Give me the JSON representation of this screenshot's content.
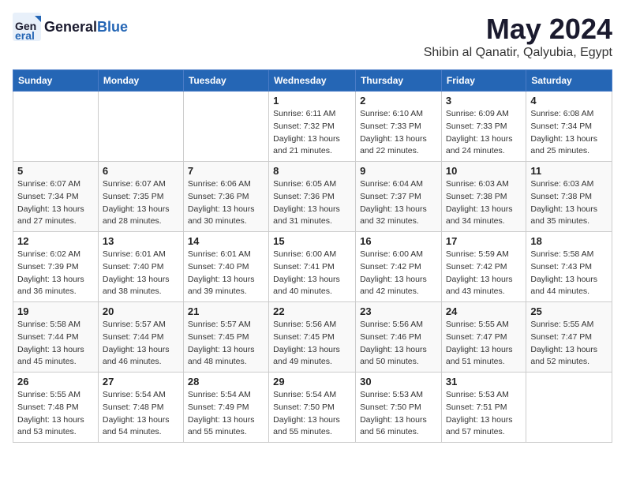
{
  "header": {
    "logo_general": "General",
    "logo_blue": "Blue",
    "month": "May 2024",
    "location": "Shibin al Qanatir, Qalyubia, Egypt"
  },
  "weekdays": [
    "Sunday",
    "Monday",
    "Tuesday",
    "Wednesday",
    "Thursday",
    "Friday",
    "Saturday"
  ],
  "weeks": [
    [
      {
        "day": "",
        "info": ""
      },
      {
        "day": "",
        "info": ""
      },
      {
        "day": "",
        "info": ""
      },
      {
        "day": "1",
        "info": "Sunrise: 6:11 AM\nSunset: 7:32 PM\nDaylight: 13 hours and 21 minutes."
      },
      {
        "day": "2",
        "info": "Sunrise: 6:10 AM\nSunset: 7:33 PM\nDaylight: 13 hours and 22 minutes."
      },
      {
        "day": "3",
        "info": "Sunrise: 6:09 AM\nSunset: 7:33 PM\nDaylight: 13 hours and 24 minutes."
      },
      {
        "day": "4",
        "info": "Sunrise: 6:08 AM\nSunset: 7:34 PM\nDaylight: 13 hours and 25 minutes."
      }
    ],
    [
      {
        "day": "5",
        "info": "Sunrise: 6:07 AM\nSunset: 7:34 PM\nDaylight: 13 hours and 27 minutes."
      },
      {
        "day": "6",
        "info": "Sunrise: 6:07 AM\nSunset: 7:35 PM\nDaylight: 13 hours and 28 minutes."
      },
      {
        "day": "7",
        "info": "Sunrise: 6:06 AM\nSunset: 7:36 PM\nDaylight: 13 hours and 30 minutes."
      },
      {
        "day": "8",
        "info": "Sunrise: 6:05 AM\nSunset: 7:36 PM\nDaylight: 13 hours and 31 minutes."
      },
      {
        "day": "9",
        "info": "Sunrise: 6:04 AM\nSunset: 7:37 PM\nDaylight: 13 hours and 32 minutes."
      },
      {
        "day": "10",
        "info": "Sunrise: 6:03 AM\nSunset: 7:38 PM\nDaylight: 13 hours and 34 minutes."
      },
      {
        "day": "11",
        "info": "Sunrise: 6:03 AM\nSunset: 7:38 PM\nDaylight: 13 hours and 35 minutes."
      }
    ],
    [
      {
        "day": "12",
        "info": "Sunrise: 6:02 AM\nSunset: 7:39 PM\nDaylight: 13 hours and 36 minutes."
      },
      {
        "day": "13",
        "info": "Sunrise: 6:01 AM\nSunset: 7:40 PM\nDaylight: 13 hours and 38 minutes."
      },
      {
        "day": "14",
        "info": "Sunrise: 6:01 AM\nSunset: 7:40 PM\nDaylight: 13 hours and 39 minutes."
      },
      {
        "day": "15",
        "info": "Sunrise: 6:00 AM\nSunset: 7:41 PM\nDaylight: 13 hours and 40 minutes."
      },
      {
        "day": "16",
        "info": "Sunrise: 6:00 AM\nSunset: 7:42 PM\nDaylight: 13 hours and 42 minutes."
      },
      {
        "day": "17",
        "info": "Sunrise: 5:59 AM\nSunset: 7:42 PM\nDaylight: 13 hours and 43 minutes."
      },
      {
        "day": "18",
        "info": "Sunrise: 5:58 AM\nSunset: 7:43 PM\nDaylight: 13 hours and 44 minutes."
      }
    ],
    [
      {
        "day": "19",
        "info": "Sunrise: 5:58 AM\nSunset: 7:44 PM\nDaylight: 13 hours and 45 minutes."
      },
      {
        "day": "20",
        "info": "Sunrise: 5:57 AM\nSunset: 7:44 PM\nDaylight: 13 hours and 46 minutes."
      },
      {
        "day": "21",
        "info": "Sunrise: 5:57 AM\nSunset: 7:45 PM\nDaylight: 13 hours and 48 minutes."
      },
      {
        "day": "22",
        "info": "Sunrise: 5:56 AM\nSunset: 7:45 PM\nDaylight: 13 hours and 49 minutes."
      },
      {
        "day": "23",
        "info": "Sunrise: 5:56 AM\nSunset: 7:46 PM\nDaylight: 13 hours and 50 minutes."
      },
      {
        "day": "24",
        "info": "Sunrise: 5:55 AM\nSunset: 7:47 PM\nDaylight: 13 hours and 51 minutes."
      },
      {
        "day": "25",
        "info": "Sunrise: 5:55 AM\nSunset: 7:47 PM\nDaylight: 13 hours and 52 minutes."
      }
    ],
    [
      {
        "day": "26",
        "info": "Sunrise: 5:55 AM\nSunset: 7:48 PM\nDaylight: 13 hours and 53 minutes."
      },
      {
        "day": "27",
        "info": "Sunrise: 5:54 AM\nSunset: 7:48 PM\nDaylight: 13 hours and 54 minutes."
      },
      {
        "day": "28",
        "info": "Sunrise: 5:54 AM\nSunset: 7:49 PM\nDaylight: 13 hours and 55 minutes."
      },
      {
        "day": "29",
        "info": "Sunrise: 5:54 AM\nSunset: 7:50 PM\nDaylight: 13 hours and 55 minutes."
      },
      {
        "day": "30",
        "info": "Sunrise: 5:53 AM\nSunset: 7:50 PM\nDaylight: 13 hours and 56 minutes."
      },
      {
        "day": "31",
        "info": "Sunrise: 5:53 AM\nSunset: 7:51 PM\nDaylight: 13 hours and 57 minutes."
      },
      {
        "day": "",
        "info": ""
      }
    ]
  ]
}
